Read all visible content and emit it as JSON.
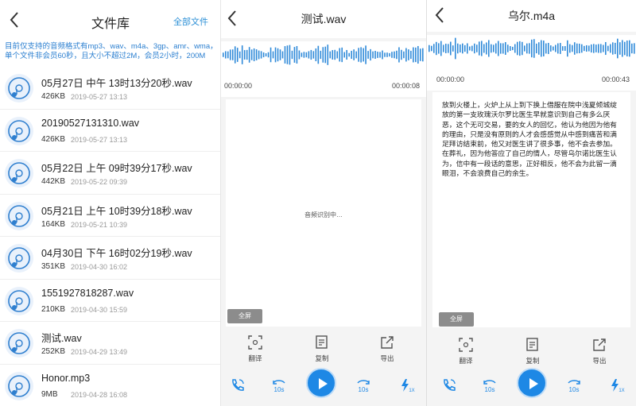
{
  "library": {
    "title": "文件库",
    "all_files_label": "全部文件",
    "notice": "目前仅支持的音频格式有mp3、wav、m4a、3gp、amr、wma，单个文件非会员60秒，且大小不超过2M，会员2小时，200M",
    "files": [
      {
        "name": "05月27日 中午 13时13分20秒.wav",
        "size": "426KB",
        "date": "2019-05-27 13:13"
      },
      {
        "name": "20190527131310.wav",
        "size": "426KB",
        "date": "2019-05-27 13:13"
      },
      {
        "name": "05月22日 上午 09时39分17秒.wav",
        "size": "442KB",
        "date": "2019-05-22 09:39"
      },
      {
        "name": "05月21日 上午 10时39分18秒.wav",
        "size": "164KB",
        "date": "2019-05-21 10:39"
      },
      {
        "name": "04月30日 下午 16时02分19秒.wav",
        "size": "351KB",
        "date": "2019-04-30 16:02"
      },
      {
        "name": "1551927818287.wav",
        "size": "210KB",
        "date": "2019-04-30 15:59"
      },
      {
        "name": "测试.wav",
        "size": "252KB",
        "date": "2019-04-29 13:49"
      },
      {
        "name": "Honor.mp3",
        "size": "9MB",
        "date": "2019-04-28 16:08"
      }
    ]
  },
  "player_a": {
    "title": "测试.wav",
    "time_start": "00:00:00",
    "time_end": "00:00:08",
    "status": "音频识别中",
    "fullscreen_label": "全屏",
    "tools": {
      "translate": "翻译",
      "copy": "复制",
      "export": "导出"
    },
    "rewind_label": "10s",
    "forward_label": "10s",
    "speed_label": "1X"
  },
  "player_b": {
    "title": "乌尔.m4a",
    "time_start": "00:00:00",
    "time_end": "00:00:43",
    "transcript": "放到火楼上，火炉上从上到下换上借服在院中浅夏倾城绽放的第一支玫瑰沃尔罗比医生早就意识到自己有多么厌恶，这个无可交易，要的女人的回忆，他认为他因为他有的理由，只是没有原则的人才会感感觉从中感到痛苦和满足拜访结束前，他又对医生讲了很多事，他不会去参加。在葬礼，因为他答应了自己的情人，尽管乌尔诺比医生认为，信中有一段话的意思，正好相反，他不会为此留一滴眼泪，不会浪费自己的余生。",
    "fullscreen_label": "全屏",
    "tools": {
      "translate": "翻译",
      "copy": "复制",
      "export": "导出"
    },
    "rewind_label": "10s",
    "forward_label": "10s",
    "speed_label": "1X"
  },
  "colors": {
    "accent": "#1e88e5",
    "link": "#2b8fd6",
    "notice": "#2b7fd0",
    "waveform": "#2f8ad9"
  },
  "icons": [
    "back-arrow-icon",
    "audio-file-icon",
    "translate-icon",
    "copy-icon",
    "export-icon",
    "call-icon",
    "rewind-10s-icon",
    "play-icon",
    "forward-10s-icon",
    "speed-icon"
  ]
}
